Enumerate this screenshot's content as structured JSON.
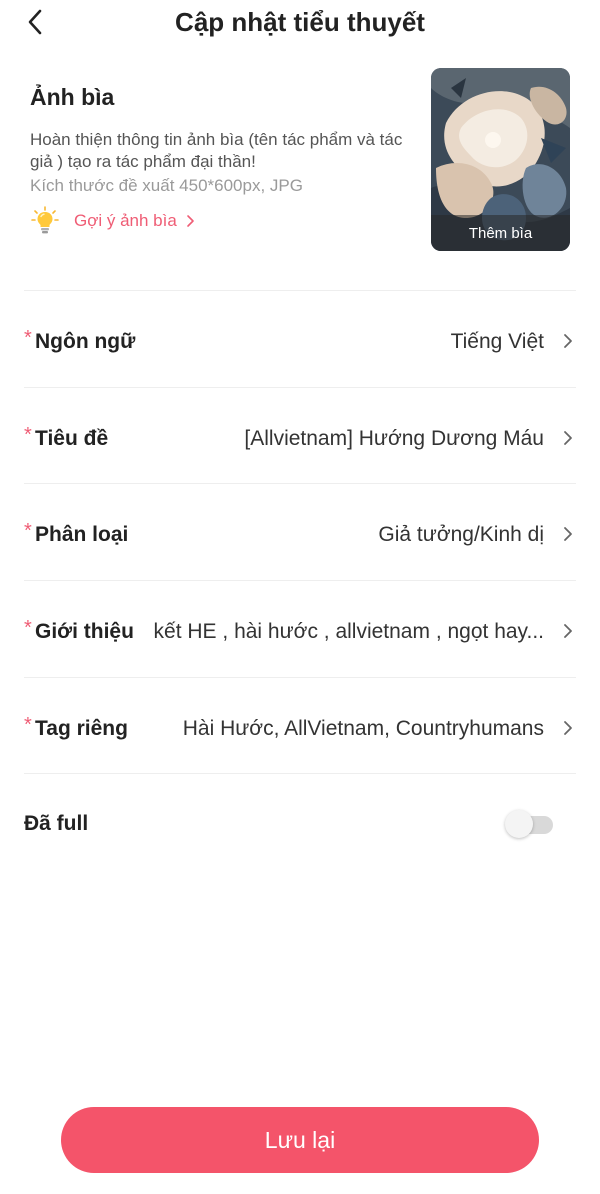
{
  "header": {
    "title": "Cập nhật tiểu thuyết",
    "back_icon": "chevron-left-icon"
  },
  "cover": {
    "heading": "Ảnh bìa",
    "description": "Hoàn thiện thông tin ảnh bìa (tên tác phẩm và tác giả ) tạo ra tác phẩm đại thần!",
    "size_hint": "Kích thước đề xuất 450*600px, JPG",
    "tip_label": "Gợi ý ảnh bìa",
    "tip_icon": "lightbulb-icon",
    "add_label": "Thêm bìa"
  },
  "fields": [
    {
      "key": "language",
      "label": "Ngôn ngữ",
      "value": "Tiếng Việt",
      "required": "*"
    },
    {
      "key": "title",
      "label": "Tiêu đề",
      "value": "[Allvietnam] Hướng Dương Máu",
      "required": "*"
    },
    {
      "key": "category",
      "label": "Phân loại",
      "value": "Giả tưởng/Kinh dị",
      "required": "*"
    },
    {
      "key": "intro",
      "label": "Giới thiệu",
      "value": "kết HE , hài hước , allvietnam , ngọt hay...",
      "required": "*"
    },
    {
      "key": "tags",
      "label": "Tag riêng",
      "value": "Hài Hước, AllVietnam, Countryhumans",
      "required": "*"
    }
  ],
  "completed": {
    "label": "Đã full",
    "on": false
  },
  "save_label": "Lưu lại",
  "colors": {
    "accent": "#f4546a",
    "required_mark": "#ef5d75",
    "tip_text": "#ef5d75"
  }
}
